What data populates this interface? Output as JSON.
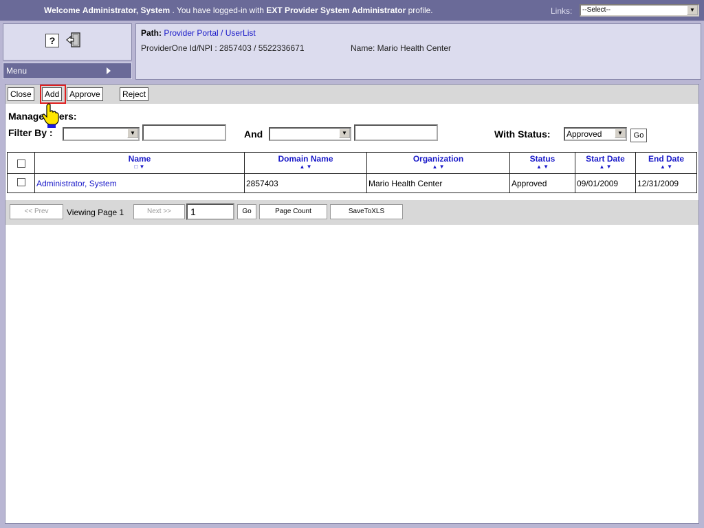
{
  "banner": {
    "welcome_prefix": "Welcome",
    "user": "Administrator, System",
    "mid": " . You have logged-in with",
    "profile": "EXT Provider System Administrator",
    "suffix": " profile.",
    "links_label": "Links:",
    "links_value": "--Select--"
  },
  "sidebar": {
    "help_label": "?",
    "menu_label": "Menu"
  },
  "path": {
    "label": "Path:",
    "value": "Provider Portal / UserList",
    "ids": "ProviderOne Id/NPI : 2857403 / 5522336671",
    "name": "Name: Mario Health Center"
  },
  "toolbar": {
    "close": "Close",
    "add": "Add",
    "approve": "Approve",
    "reject": "Reject"
  },
  "filters": {
    "title": "Manage Users:",
    "filter_by": "Filter By :",
    "and": "And",
    "with_status": "With Status:",
    "status_value": "Approved",
    "go": "Go"
  },
  "table": {
    "headers": [
      "Name",
      "Domain Name",
      "Organization",
      "Status",
      "Start Date",
      "End Date"
    ],
    "rows": [
      [
        "Administrator, System",
        "2857403",
        "Mario Health Center",
        "Approved",
        "09/01/2009",
        "12/31/2009"
      ]
    ]
  },
  "pager": {
    "prev": "<< Prev",
    "viewing": "Viewing Page 1",
    "next": "Next >>",
    "page": "1",
    "go": "Go",
    "page_count": "Page Count",
    "save": "SaveToXLS"
  }
}
